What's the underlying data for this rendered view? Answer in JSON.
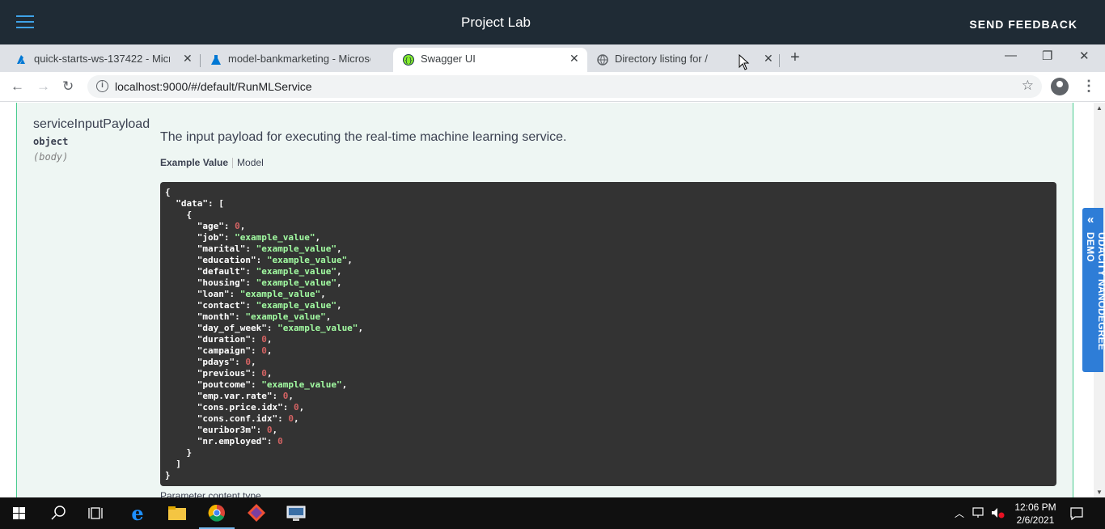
{
  "app": {
    "title": "Project Lab",
    "feedback_label": "SEND FEEDBACK"
  },
  "browser": {
    "tabs": [
      {
        "label": "quick-starts-ws-137422 - Microsoft",
        "active": false
      },
      {
        "label": "model-bankmarketing - Microsoft",
        "active": false
      },
      {
        "label": "Swagger UI",
        "active": true
      },
      {
        "label": "Directory listing for /",
        "active": false
      }
    ],
    "url": "localhost:9000/#/default/RunMLService"
  },
  "parameter": {
    "name": "serviceInputPayload",
    "type": "object",
    "location": "(body)",
    "description": "The input payload for executing the real-time machine learning service.",
    "tab_example": "Example Value",
    "tab_model": "Model",
    "content_type_label": "Parameter content type"
  },
  "example": {
    "open_brace": "{",
    "data_key": "\"data\"",
    "fields": [
      {
        "key": "age",
        "value": "0",
        "kind": "number"
      },
      {
        "key": "job",
        "value": "\"example_value\"",
        "kind": "string"
      },
      {
        "key": "marital",
        "value": "\"example_value\"",
        "kind": "string"
      },
      {
        "key": "education",
        "value": "\"example_value\"",
        "kind": "string"
      },
      {
        "key": "default",
        "value": "\"example_value\"",
        "kind": "string"
      },
      {
        "key": "housing",
        "value": "\"example_value\"",
        "kind": "string"
      },
      {
        "key": "loan",
        "value": "\"example_value\"",
        "kind": "string"
      },
      {
        "key": "contact",
        "value": "\"example_value\"",
        "kind": "string"
      },
      {
        "key": "month",
        "value": "\"example_value\"",
        "kind": "string"
      },
      {
        "key": "day_of_week",
        "value": "\"example_value\"",
        "kind": "string"
      },
      {
        "key": "duration",
        "value": "0",
        "kind": "number"
      },
      {
        "key": "campaign",
        "value": "0",
        "kind": "number"
      },
      {
        "key": "pdays",
        "value": "0",
        "kind": "number"
      },
      {
        "key": "previous",
        "value": "0",
        "kind": "number"
      },
      {
        "key": "poutcome",
        "value": "\"example_value\"",
        "kind": "string"
      },
      {
        "key": "emp.var.rate",
        "value": "0",
        "kind": "number"
      },
      {
        "key": "cons.price.idx",
        "value": "0",
        "kind": "number"
      },
      {
        "key": "cons.conf.idx",
        "value": "0",
        "kind": "number"
      },
      {
        "key": "euribor3m",
        "value": "0",
        "kind": "number"
      },
      {
        "key": "nr.employed",
        "value": "0",
        "kind": "number"
      }
    ]
  },
  "udacity_tab": "UDACITY NANODEGREE DEMO",
  "taskbar": {
    "time": "12:06 PM",
    "date": "2/6/2021"
  },
  "colors": {
    "appbar": "#1f2b35",
    "accent": "#3fa3e8",
    "panel_bg": "#eef6f3",
    "panel_border": "#49cc90",
    "code_bg": "#333333",
    "code_string": "#a2fca2",
    "code_number": "#d36363"
  }
}
